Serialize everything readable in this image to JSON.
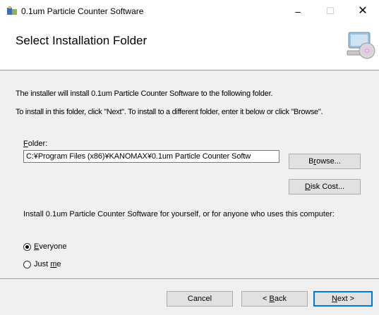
{
  "window": {
    "title": "0.1um Particle Counter Software",
    "controls": {
      "minimize": "–",
      "maximize": "☐",
      "close": "✕"
    }
  },
  "header": {
    "title": "Select Installation Folder"
  },
  "body": {
    "line1": "The installer will install 0.1um Particle Counter Software to the following folder.",
    "line2": "To install in this folder, click \"Next\". To install to a different folder, enter it below or click \"Browse\".",
    "folder_label": "Folder:",
    "folder_value": "C:¥Program Files (x86)¥KANOMAX¥0.1um Particle Counter Softw",
    "browse_label": "Browse...",
    "diskcost_label": "Disk Cost...",
    "install_for_text": "Install 0.1um Particle Counter Software for yourself, or for anyone who uses this computer:",
    "radio_options": [
      {
        "label": "Everyone",
        "selected": true
      },
      {
        "label": "Just me",
        "selected": false
      }
    ]
  },
  "footer": {
    "cancel_label": "Cancel",
    "back_label": "< Back",
    "next_label": "Next >"
  },
  "colors": {
    "accent": "#0078d7",
    "panel": "#f0f0f0",
    "header_bg": "#ffffff"
  }
}
